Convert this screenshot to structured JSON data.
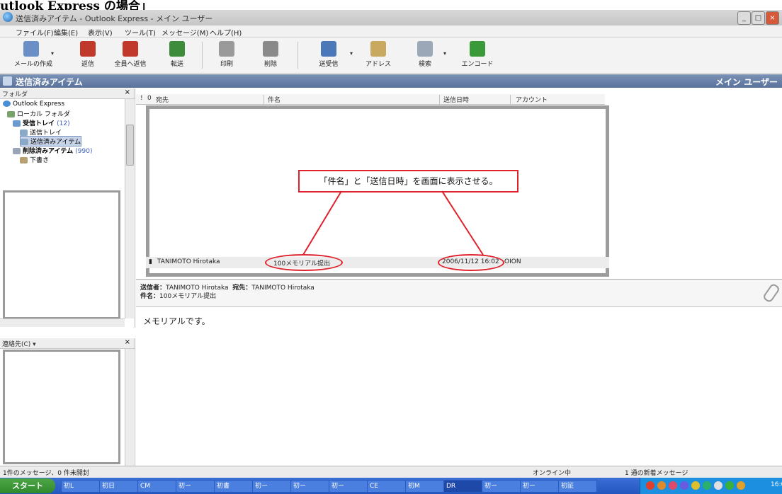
{
  "page_header": "utlook Express の場合」",
  "window": {
    "title": "送信済みアイテム - Outlook Express - メイン ユーザー",
    "controls": [
      "minimize",
      "maximize",
      "close"
    ]
  },
  "menu": [
    "ファイル(F)",
    "編集(E)",
    "表示(V)",
    "ツール(T)",
    "メッセージ(M)",
    "ヘルプ(H)"
  ],
  "toolbar": [
    {
      "label": "メールの作成",
      "icon": "compose-icon",
      "color": "#6a8fc6"
    },
    {
      "label": "返信",
      "icon": "reply-icon",
      "color": "#c0392b"
    },
    {
      "label": "全員へ返信",
      "icon": "reply-all-icon",
      "color": "#c0392b"
    },
    {
      "label": "転送",
      "icon": "forward-icon",
      "color": "#3c8c3c"
    },
    {
      "label": "印刷",
      "icon": "print-icon",
      "color": "#9a9a9a"
    },
    {
      "label": "削除",
      "icon": "delete-icon",
      "color": "#8a8a8a"
    },
    {
      "label": "送受信",
      "icon": "send-receive-icon",
      "color": "#4a78b8"
    },
    {
      "label": "アドレス",
      "icon": "address-book-icon",
      "color": "#c9a860"
    },
    {
      "label": "検索",
      "icon": "find-icon",
      "color": "#9aa8b8"
    },
    {
      "label": "エンコード",
      "icon": "encoding-icon",
      "color": "#3a9a3a"
    }
  ],
  "folder_bar": {
    "title": "送信済みアイテム",
    "identity": "メイン ユーザー"
  },
  "folders_pane": {
    "title": "フォルダ",
    "items": [
      {
        "label": "Outlook Express",
        "count": ""
      },
      {
        "label": "ローカル フォルダ",
        "count": ""
      },
      {
        "label": "受信トレイ",
        "count": "(12)"
      },
      {
        "label": "送信トレイ",
        "count": ""
      },
      {
        "label": "送信済みアイテム",
        "count": ""
      },
      {
        "label": "削除済みアイテム",
        "count": "(990)"
      },
      {
        "label": "下書き",
        "count": ""
      }
    ]
  },
  "contacts_pane": {
    "title": "連絡先(C) ▾"
  },
  "message_list": {
    "columns": [
      "!",
      "0",
      "宛先",
      "件名",
      "送信日時",
      "アカウント"
    ],
    "row": {
      "to": "TANIMOTO Hirotaka",
      "subject": "100メモリアル提出",
      "sent": "2006/11/12 16:02",
      "account": "OION"
    }
  },
  "annotation": "「件名」と「送信日時」を画面に表示させる。",
  "preview": {
    "from_label": "送信者：",
    "from": "TANIMOTO Hirotaka",
    "to_label": "宛先：",
    "to": "TANIMOTO Hirotaka",
    "subject_label": "件名：",
    "subject": "100メモリアル提出",
    "body": "メモリアルです。"
  },
  "status": {
    "left": "1件のメッセージ、0 件未開封",
    "online": "オンライン中",
    "unread": "1 通の新着メッセージ"
  },
  "taskbar": {
    "start": "スタート",
    "tasks": [
      "初L",
      "初日",
      "CM",
      "初ー",
      "初書",
      "初ー",
      "初ー",
      "初ー",
      "CE",
      "初M",
      "DR",
      "初ー",
      "初ー",
      "初証"
    ],
    "clock": "16:0"
  },
  "colors": {
    "accent": "#5a729c",
    "annotation": "#e0202a",
    "taskbar": "#2456c0"
  }
}
